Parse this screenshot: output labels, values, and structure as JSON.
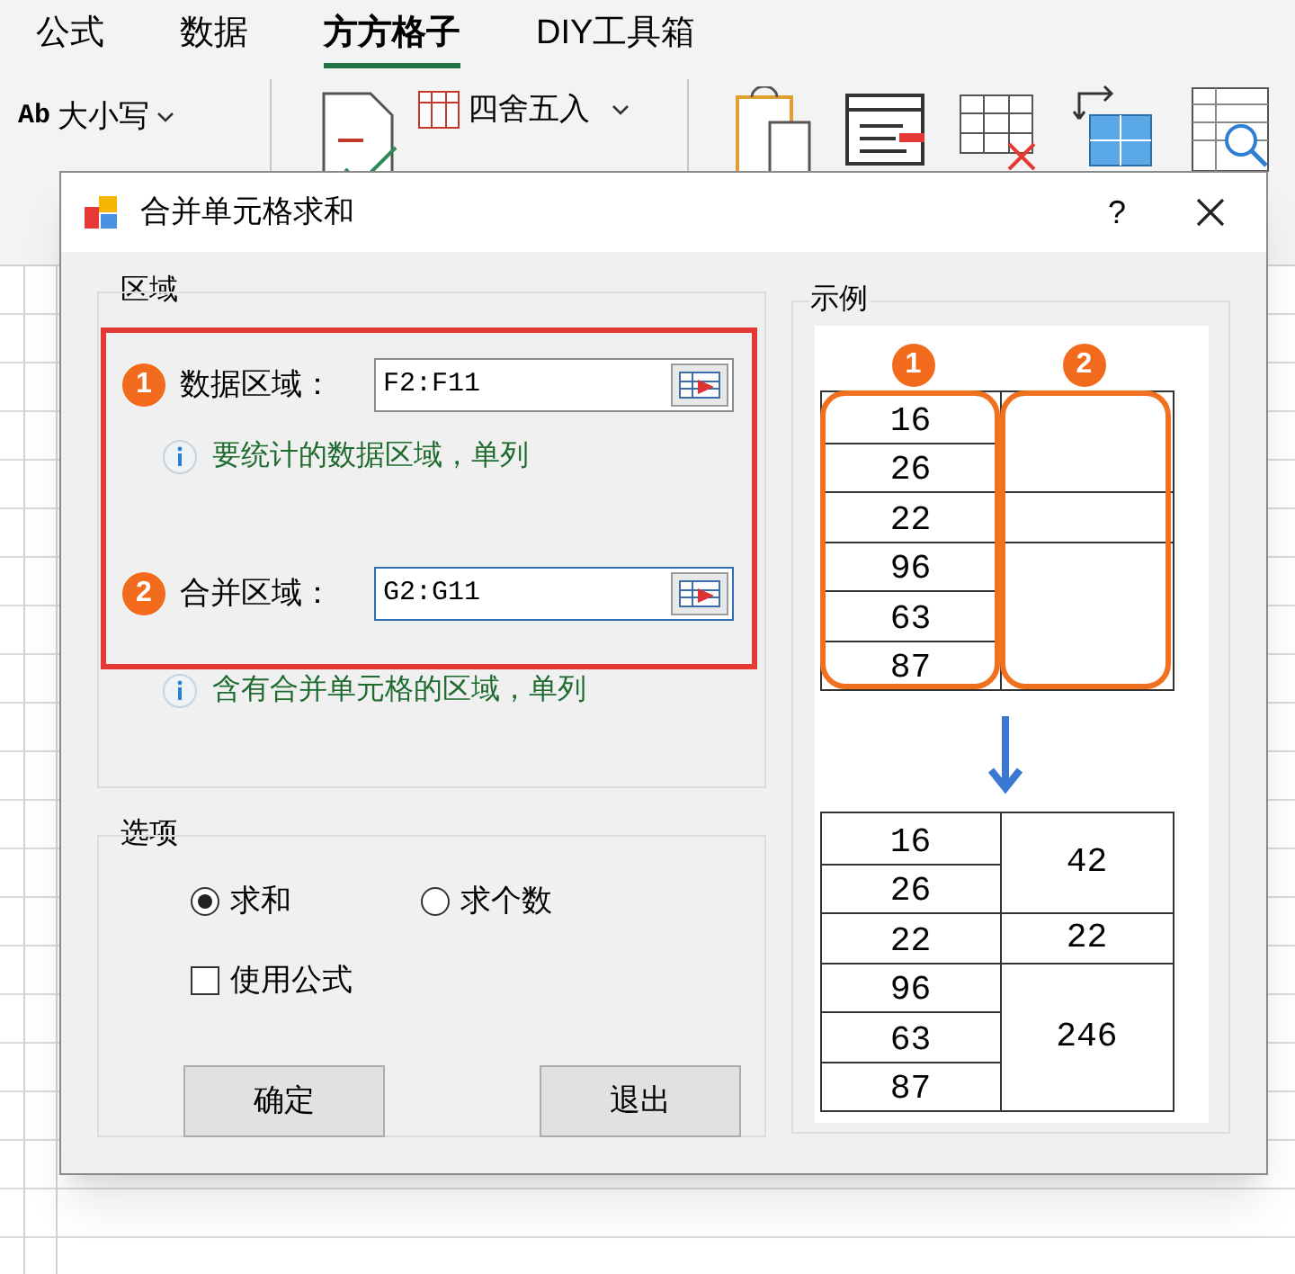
{
  "tabs": [
    {
      "label": "公式",
      "selected": false
    },
    {
      "label": "数据",
      "selected": false
    },
    {
      "label": "方方格子",
      "selected": true
    },
    {
      "label": "DIY工具箱",
      "selected": false
    }
  ],
  "ribbon": {
    "case_icon_text": "Ab",
    "case_button": "大小写",
    "round_button": "四舍五入"
  },
  "dialog": {
    "title": "合并单元格求和",
    "help": "?",
    "region_group": {
      "title": "区域",
      "fields": [
        {
          "badge": "1",
          "label": "数据区域：",
          "value": "F2:F11",
          "hint": "要统计的数据区域，单列",
          "focused": false
        },
        {
          "badge": "2",
          "label": "合并区域：",
          "value": "G2:G11",
          "hint": "含有合并单元格的区域，单列",
          "focused": true
        }
      ]
    },
    "options": {
      "title": "选项",
      "radios": [
        {
          "label": "求和",
          "selected": true
        },
        {
          "label": "求个数",
          "selected": false
        }
      ],
      "checkboxes": [
        {
          "label": "使用公式",
          "checked": false
        }
      ]
    },
    "buttons": [
      "确定",
      "退出"
    ],
    "example": {
      "title": "示例",
      "badges": [
        "1",
        "2"
      ],
      "before": [
        {
          "values": [
            "16",
            "26"
          ]
        },
        {
          "values": [
            "22"
          ]
        },
        {
          "values": [
            "96",
            "63",
            "87"
          ]
        }
      ],
      "after": [
        {
          "values": [
            "16",
            "26"
          ],
          "sum": "42"
        },
        {
          "values": [
            "22"
          ],
          "sum": "22"
        },
        {
          "values": [
            "96",
            "63",
            "87"
          ],
          "sum": "246"
        }
      ]
    }
  }
}
